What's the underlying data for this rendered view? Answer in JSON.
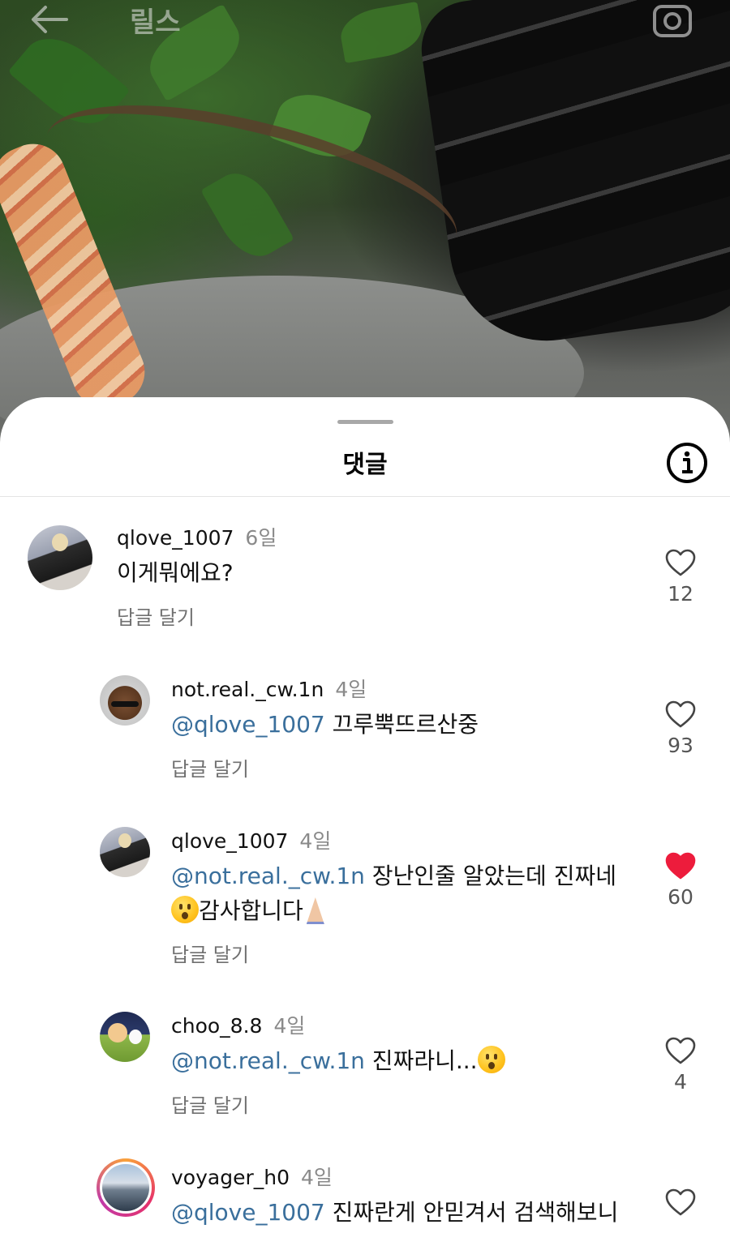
{
  "header": {
    "title": "릴스"
  },
  "sheet": {
    "title": "댓글"
  },
  "comments": [
    {
      "username": "qlove_1007",
      "time": "6일",
      "text": "이게뭐에요?",
      "reply_label": "답글 달기",
      "likes": "12",
      "liked": false
    },
    {
      "username": "not.real._cw.1n",
      "time": "4일",
      "mention": "@qlove_1007",
      "text": " 끄루뿍뜨르산중",
      "reply_label": "답글 달기",
      "likes": "93",
      "liked": false
    },
    {
      "username": "qlove_1007",
      "time": "4일",
      "mention": "@not.real._cw.1n",
      "text": " 장난인줄 알았는데 진짜네",
      "text_line2": "감사합니다",
      "reply_label": "답글 달기",
      "likes": "60",
      "liked": true
    },
    {
      "username": "choo_8.8",
      "time": "4일",
      "mention": "@not.real._cw.1n",
      "text": " 진짜라니...",
      "reply_label": "답글 달기",
      "likes": "4",
      "liked": false
    },
    {
      "username": "voyager_h0",
      "time": "4일",
      "mention": "@qlove_1007",
      "text": " 진짜란게 안믿겨서 검색해보니",
      "likes": "",
      "liked": false
    }
  ],
  "colors": {
    "mention": "#3a6f9c",
    "liked_heart": "#ed1c3c",
    "secondary_text": "#8a8a8a"
  },
  "icons": [
    "back-arrow-icon",
    "camera-icon",
    "info-icon",
    "heart-outline-icon",
    "heart-filled-icon",
    "astonished-face-emoji",
    "folded-hands-emoji"
  ]
}
